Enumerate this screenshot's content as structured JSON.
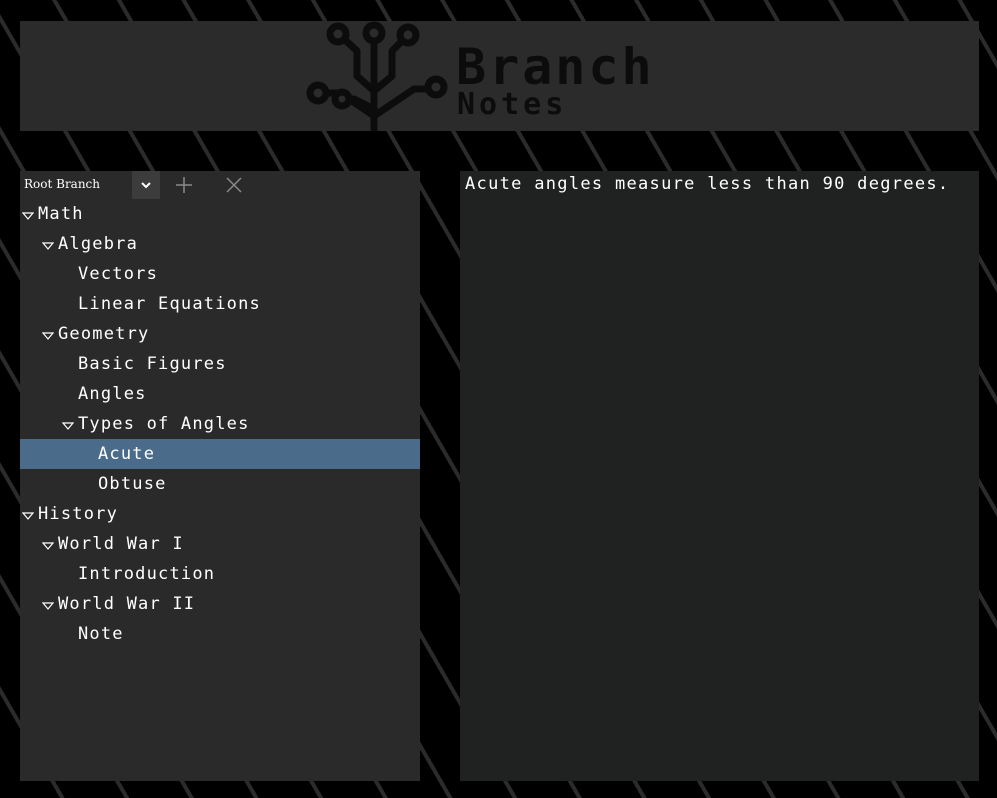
{
  "header": {
    "logo_icon": "circuit-tree-icon",
    "logo_title": "Branch",
    "logo_subtitle": "Notes"
  },
  "toolbar": {
    "branch_selector": "Root Branch",
    "dropdown_icon": "chevron-down-icon",
    "add_icon": "plus-icon",
    "delete_icon": "close-icon"
  },
  "tree": {
    "items": [
      {
        "label": "Math",
        "depth": 0,
        "expanded": true
      },
      {
        "label": "Algebra",
        "depth": 1,
        "expanded": true
      },
      {
        "label": "Vectors",
        "depth": 2
      },
      {
        "label": "Linear Equations",
        "depth": 2
      },
      {
        "label": "Geometry",
        "depth": 1,
        "expanded": true
      },
      {
        "label": "Basic Figures",
        "depth": 2
      },
      {
        "label": "Angles",
        "depth": 2
      },
      {
        "label": "Types of Angles",
        "depth": 2,
        "expanded": true
      },
      {
        "label": "Acute",
        "depth": 3,
        "selected": true
      },
      {
        "label": "Obtuse",
        "depth": 3
      },
      {
        "label": "History",
        "depth": 0,
        "expanded": true
      },
      {
        "label": "World War I",
        "depth": 1,
        "expanded": true
      },
      {
        "label": "Introduction",
        "depth": 2
      },
      {
        "label": "World War II",
        "depth": 1,
        "expanded": true
      },
      {
        "label": "Note",
        "depth": 2
      }
    ]
  },
  "content": {
    "text": "Acute angles measure less than 90 degrees."
  },
  "colors": {
    "background": "#000000",
    "panel": "#2a2a2a",
    "content_panel": "#202222",
    "selection": "#4a6b8a",
    "text": "#ffffff"
  }
}
